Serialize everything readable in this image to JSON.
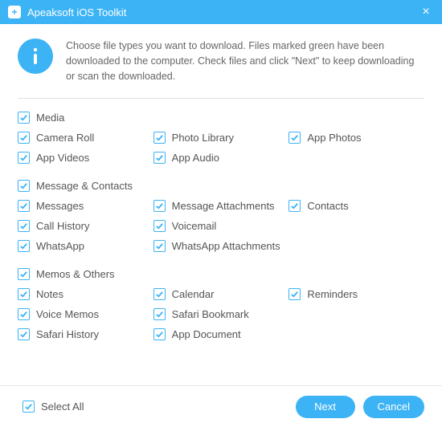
{
  "titlebar": {
    "title": "Apeaksoft iOS Toolkit",
    "close_label": "×"
  },
  "info": {
    "text": "Choose file types you want to download. Files marked green have been downloaded to the computer. Check files and click \"Next\" to keep downloading or scan the downloaded."
  },
  "groups": [
    {
      "header": "Media",
      "items": [
        {
          "label": "Camera Roll"
        },
        {
          "label": "Photo Library"
        },
        {
          "label": "App Photos"
        },
        {
          "label": "App Videos"
        },
        {
          "label": "App Audio"
        }
      ]
    },
    {
      "header": "Message & Contacts",
      "items": [
        {
          "label": "Messages"
        },
        {
          "label": "Message Attachments"
        },
        {
          "label": "Contacts"
        },
        {
          "label": "Call History"
        },
        {
          "label": "Voicemail"
        },
        {
          "label": "",
          "skip": true
        },
        {
          "label": "WhatsApp"
        },
        {
          "label": "WhatsApp Attachments"
        }
      ]
    },
    {
      "header": "Memos & Others",
      "items": [
        {
          "label": "Notes"
        },
        {
          "label": "Calendar"
        },
        {
          "label": "Reminders"
        },
        {
          "label": "Voice Memos"
        },
        {
          "label": "Safari Bookmark"
        },
        {
          "label": "",
          "skip": true
        },
        {
          "label": "Safari History"
        },
        {
          "label": "App Document"
        }
      ]
    }
  ],
  "footer": {
    "select_all": "Select All",
    "next": "Next",
    "cancel": "Cancel"
  },
  "colors": {
    "accent": "#3cb3f5"
  }
}
